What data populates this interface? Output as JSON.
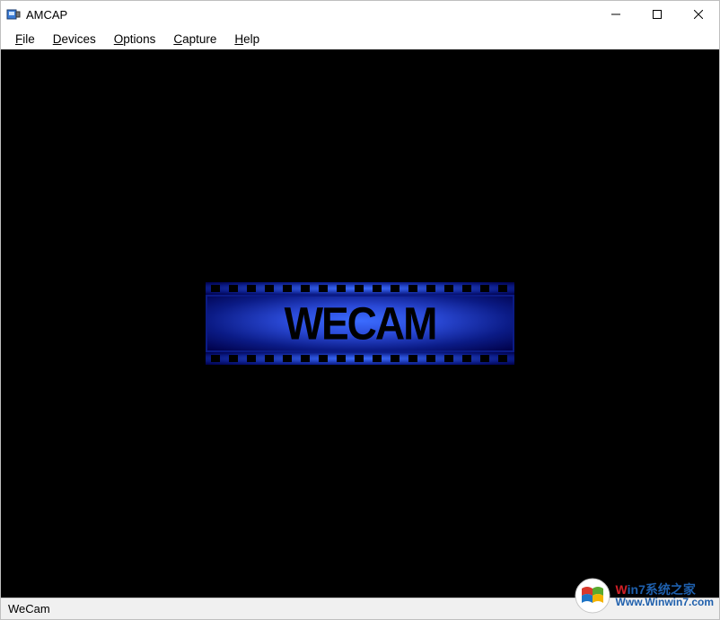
{
  "window": {
    "title": "AMCAP"
  },
  "menubar": {
    "file": "File",
    "file_hotkey": "F",
    "devices": "Devices",
    "devices_hotkey": "D",
    "options": "Options",
    "options_hotkey": "O",
    "capture": "Capture",
    "capture_hotkey": "C",
    "help": "Help",
    "help_hotkey": "H"
  },
  "preview": {
    "logo_text": "WECAM"
  },
  "statusbar": {
    "text": "WeCam"
  },
  "watermark": {
    "brand_prefix": "W",
    "brand_mid": "in7",
    "brand_cn": "系统之家",
    "url": "Www.Winwin7.com"
  },
  "colors": {
    "logo_blue_light": "#3b6cff",
    "logo_blue_dark": "#0b1b86",
    "accent_red": "#d32027",
    "accent_blue": "#1e5fac"
  }
}
